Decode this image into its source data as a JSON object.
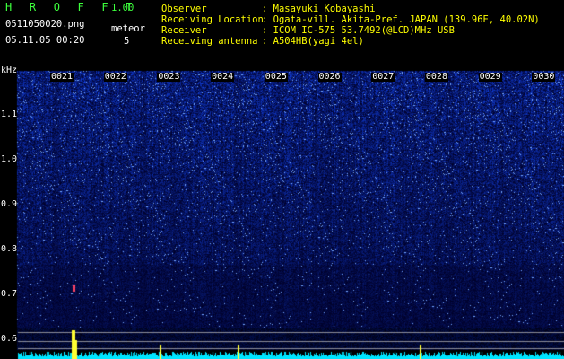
{
  "app": {
    "name": "H R O F F T",
    "version": "1.00"
  },
  "file": {
    "name": "0511050020.png",
    "datetime": "05.11.05 00:20"
  },
  "meteor": {
    "label": "meteor",
    "count": "5"
  },
  "info": {
    "observer": {
      "label": "Observer",
      "value": ": Masayuki Kobayashi"
    },
    "location": {
      "label": "Receiving Location",
      "value": ": Ogata-vill. Akita-Pref. JAPAN (139.96E, 40.02N)"
    },
    "receiver": {
      "label": "Receiver",
      "value": ": ICOM IC-575 53.7492(@LCD)MHz USB"
    },
    "antenna": {
      "label": "Receiving antenna",
      "value": ": A504HB(yagi 4el)"
    }
  },
  "axis": {
    "y_unit": "kHz",
    "y_ticks": [
      "1.1",
      "1.0",
      "0.9",
      "0.8",
      "0.7",
      "0.6"
    ],
    "x_ticks": [
      "0021",
      "0022",
      "0023",
      "0024",
      "0025",
      "0026",
      "0027",
      "0028",
      "0029",
      "0030"
    ]
  },
  "colors": {
    "background": "#000000",
    "spectrum": "#1e3cff",
    "trace": "#00e5ff",
    "header_green": "#3dff3d",
    "header_yellow": "#ffff00"
  }
}
